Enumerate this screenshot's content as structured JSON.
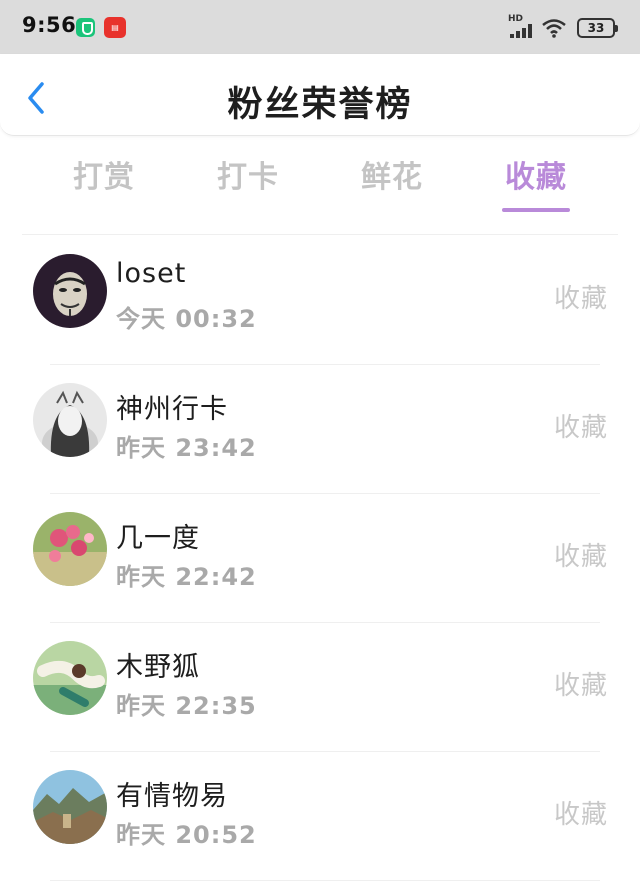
{
  "status_bar": {
    "time": "9:56",
    "battery": "33",
    "network_label": "HD"
  },
  "header": {
    "title": "粉丝荣誉榜"
  },
  "tabs": [
    {
      "label": "打赏",
      "active": false
    },
    {
      "label": "打卡",
      "active": false
    },
    {
      "label": "鲜花",
      "active": false
    },
    {
      "label": "收藏",
      "active": true
    }
  ],
  "accent_color": "#b98ad9",
  "fans": [
    {
      "name": "loset",
      "time": "今天 00:32",
      "action": "收藏"
    },
    {
      "name": "神州行卡",
      "time": "昨天 23:42",
      "action": "收藏"
    },
    {
      "name": "几一度",
      "time": "昨天 22:42",
      "action": "收藏"
    },
    {
      "name": "木野狐",
      "time": "昨天 22:35",
      "action": "收藏"
    },
    {
      "name": "有情物易",
      "time": "昨天 20:52",
      "action": "收藏"
    }
  ]
}
